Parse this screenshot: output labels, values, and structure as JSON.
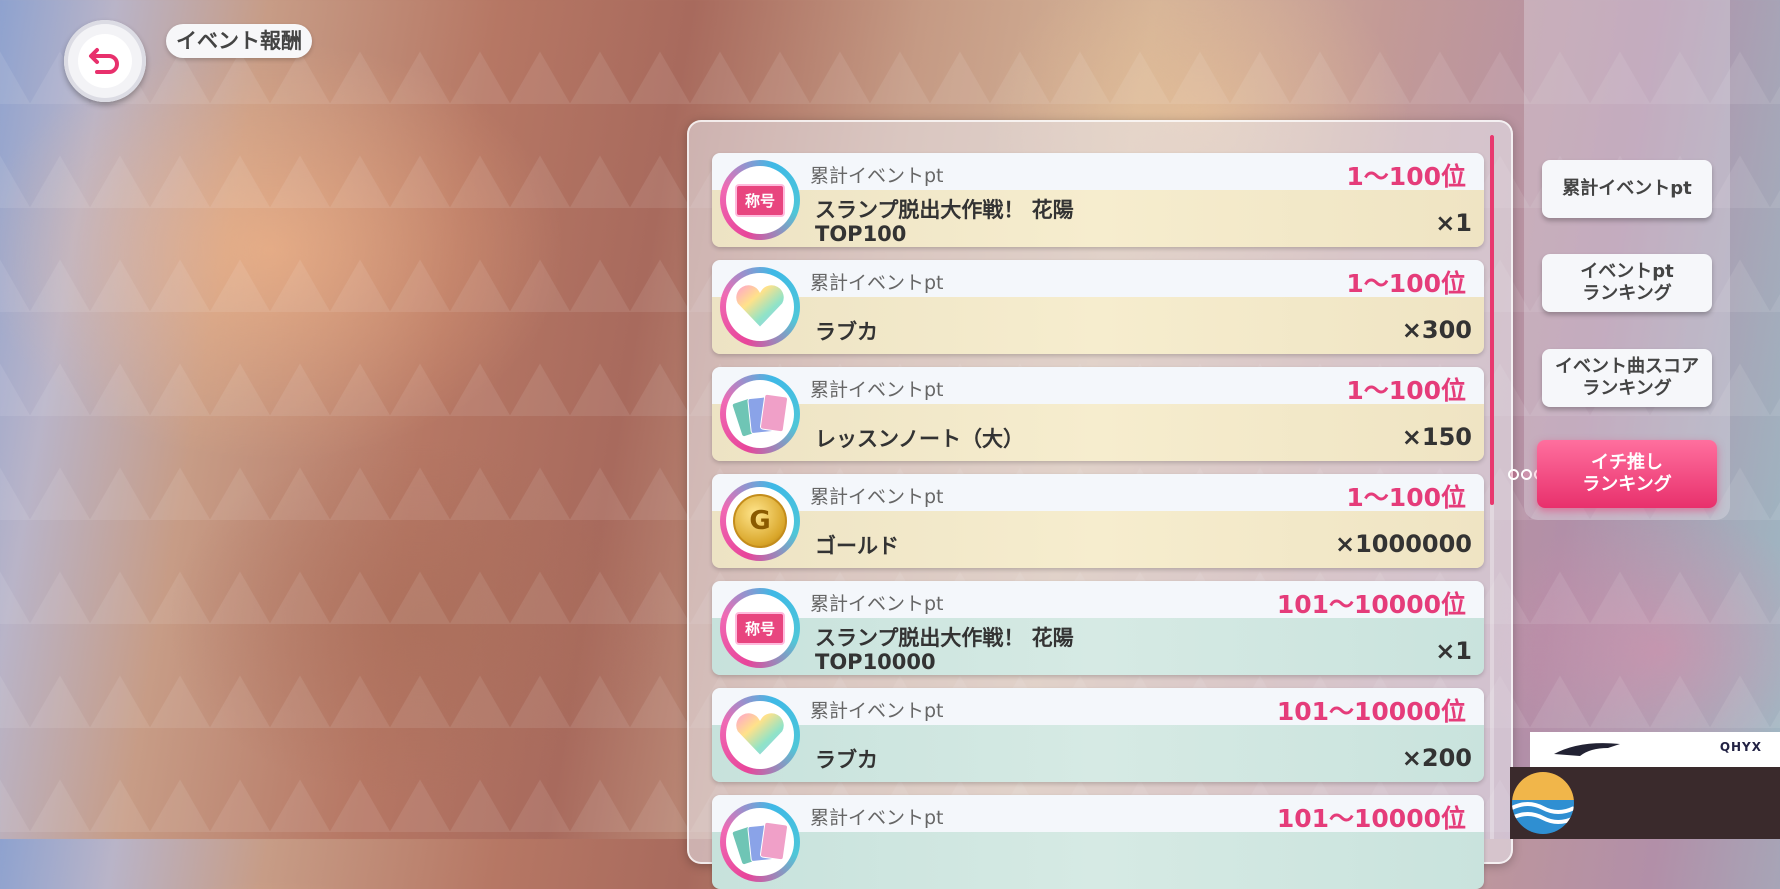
{
  "header": {
    "title": "イベント報酬"
  },
  "rewards": [
    {
      "type": "累計イベントpt",
      "rank": "1～100位",
      "name_line1": "スランプ脱出大作戦！ 花陽",
      "name_line2": "TOP100",
      "qty": "×1",
      "icon": "title-badge-icon",
      "icon_label": "称号"
    },
    {
      "type": "累計イベントpt",
      "rank": "1～100位",
      "name_line1": "ラブカ",
      "qty": "×300",
      "icon": "love-gem-icon"
    },
    {
      "type": "累計イベントpt",
      "rank": "1～100位",
      "name_line1": "レッスンノート（大）",
      "qty": "×150",
      "icon": "lesson-note-icon"
    },
    {
      "type": "累計イベントpt",
      "rank": "1～100位",
      "name_line1": "ゴールド",
      "qty": "×1000000",
      "icon": "gold-coin-icon",
      "icon_label": "G"
    },
    {
      "type": "累計イベントpt",
      "rank": "101～10000位",
      "name_line1": "スランプ脱出大作戦！ 花陽",
      "name_line2": "TOP10000",
      "qty": "×1",
      "icon": "title-badge-icon",
      "icon_label": "称号"
    },
    {
      "type": "累計イベントpt",
      "rank": "101～10000位",
      "name_line1": "ラブカ",
      "qty": "×200",
      "icon": "love-gem-icon"
    },
    {
      "type": "累計イベントpt",
      "rank": "101～10000位",
      "name_line1": "",
      "qty": "",
      "icon": "lesson-note-icon"
    }
  ],
  "side_tabs": [
    {
      "label": "累計イベントpt"
    },
    {
      "label": "イベントpt\nランキング"
    },
    {
      "label": "イベント曲スコア\nランキング"
    },
    {
      "label": "イチ推し\nランキング",
      "active": true
    }
  ],
  "colors": {
    "accent": "#e8306c",
    "rank_text": "#e53c7a",
    "top_tier_bg": "#f6edce",
    "second_tier_bg": "#d6eae4"
  }
}
